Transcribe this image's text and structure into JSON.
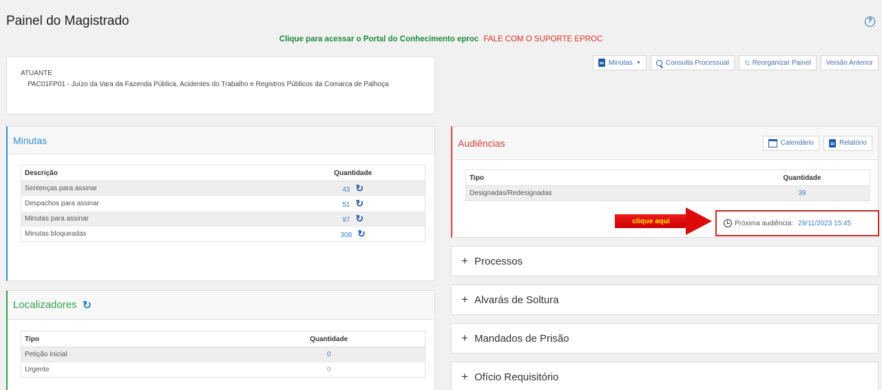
{
  "header": {
    "title": "Painel do Magistrado",
    "help_icon": "help-icon",
    "portal_link": "Clique para acessar o Portal do Conhecimento eproc",
    "support_link": "FALE COM O SUPORTE EPROC"
  },
  "toolbar": {
    "minutas": "Minutas",
    "consulta": "Consulta Processual",
    "reorganizar": "Reorganizar Painel",
    "versao": "Versão Anterior"
  },
  "atuante": {
    "label": "ATUANTE",
    "text": "PAC01FP01 - Juízo da Vara da Fazenda Pública, Acidentes do Trabalho e Registros Públicos da Comarca de Palhoça"
  },
  "minutas": {
    "title": "Minutas",
    "col_desc": "Descrição",
    "col_qty": "Quantidade",
    "rows": [
      {
        "desc": "Sentenças para assinar",
        "qty": "43"
      },
      {
        "desc": "Despachos para assinar",
        "qty": "51"
      },
      {
        "desc": "Minutas para assinar",
        "qty": "97"
      },
      {
        "desc": "Minutas bloqueadas",
        "qty": "308"
      }
    ]
  },
  "localizadores": {
    "title": "Localizadores",
    "col_tipo": "Tipo",
    "col_qty": "Quantidade",
    "rows": [
      {
        "tipo": "Petição Inicial",
        "qty": "0"
      },
      {
        "tipo": "Urgente",
        "qty": "0"
      }
    ]
  },
  "audiencias": {
    "title": "Audiências",
    "btn_calendario": "Calendário",
    "btn_relatorio": "Relatório",
    "col_tipo": "Tipo",
    "col_qty": "Quantidade",
    "rows": [
      {
        "tipo": "Designadas/Redesignadas",
        "qty": "39"
      }
    ],
    "proxima_label": "Próxima audiência:",
    "proxima_value": "29/11/2023 15:45"
  },
  "annotation": {
    "arrow_text": "clique aqui",
    "color": "#dd0a0a"
  },
  "accordions": [
    {
      "label": "Processos"
    },
    {
      "label": "Alvarás de Soltura"
    },
    {
      "label": "Mandados de Prisão"
    },
    {
      "label": "Ofício Requisitório"
    }
  ],
  "colors": {
    "minutas_accent": "#2f8fd0",
    "localizadores_accent": "#2ea44f",
    "audiencias_accent": "#d23c3c",
    "link_green": "#1e8a3d",
    "link_red": "#d93025"
  }
}
